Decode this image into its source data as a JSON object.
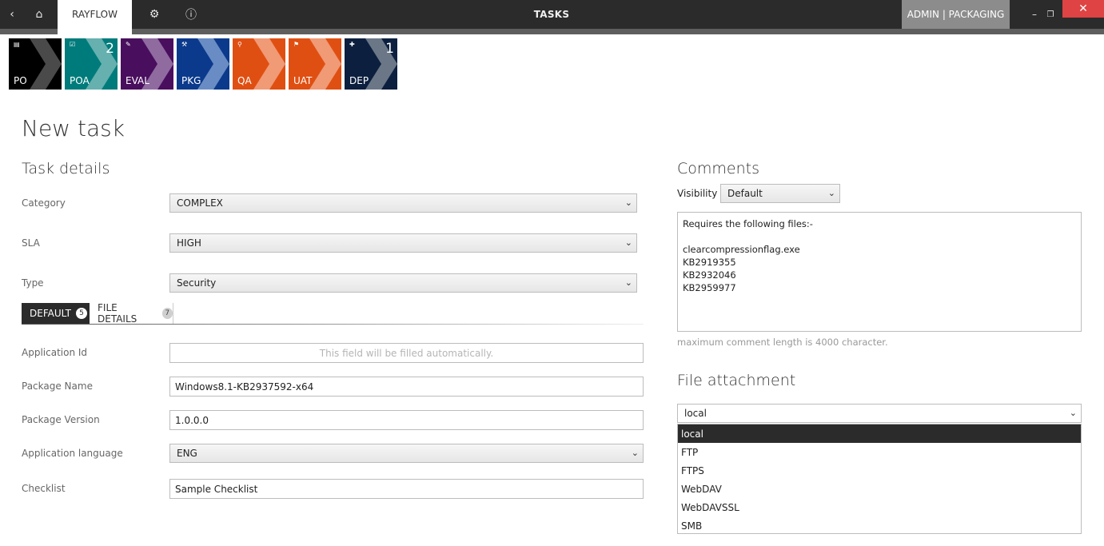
{
  "titlebar": {
    "app_tab": "RAYFLOW",
    "title": "TASKS",
    "user": "ADMIN | PACKAGING",
    "back_icon": "‹",
    "home_icon": "⌂",
    "gear_icon": "⚙",
    "info_icon": "ⓘ",
    "min_icon": "–",
    "max_icon": "❐",
    "close_icon": "✕"
  },
  "phases": [
    {
      "label": "PO",
      "count": "",
      "icon": "▤",
      "color": "#000000",
      "chevron": "#4a4a4a"
    },
    {
      "label": "POA",
      "count": "2",
      "icon": "☑",
      "color": "#007b7b",
      "chevron": "#66b0b0"
    },
    {
      "label": "EVAL",
      "count": "",
      "icon": "✎",
      "color": "#4a0e5e",
      "chevron": "#8f6ba0"
    },
    {
      "label": "PKG",
      "count": "",
      "icon": "⚒",
      "color": "#0b3a8c",
      "chevron": "#6a8cc4"
    },
    {
      "label": "QA",
      "count": "",
      "icon": "⚲",
      "color": "#e04f12",
      "chevron": "#f09a76"
    },
    {
      "label": "UAT",
      "count": "",
      "icon": "⚑",
      "color": "#e04f12",
      "chevron": "#f09a76"
    },
    {
      "label": "DEP",
      "count": "1",
      "icon": "✚",
      "color": "#0c1f3f",
      "chevron": "#6b7787"
    }
  ],
  "page": {
    "title": "New task"
  },
  "task_details": {
    "heading": "Task details",
    "category": {
      "label": "Category",
      "value": "COMPLEX"
    },
    "sla": {
      "label": "SLA",
      "value": "HIGH"
    },
    "type": {
      "label": "Type",
      "value": "Security"
    }
  },
  "tabs": [
    {
      "label": "DEFAULT",
      "badge": "5"
    },
    {
      "label": "FILE DETAILS",
      "badge": "7"
    }
  ],
  "fields": {
    "application_id": {
      "label": "Application Id",
      "placeholder": "This field will be filled automatically."
    },
    "package_name": {
      "label": "Package Name",
      "value": "Windows8.1-KB2937592-x64"
    },
    "package_version": {
      "label": "Package Version",
      "value": "1.0.0.0"
    },
    "application_language": {
      "label": "Application language",
      "value": "ENG"
    },
    "checklist": {
      "label": "Checklist",
      "value": "Sample Checklist"
    }
  },
  "comments": {
    "heading": "Comments",
    "visibility_label": "Visibility",
    "visibility_value": "Default",
    "lines": [
      "Requires the following files:-",
      "",
      "clearcompressionflag.exe",
      "KB2919355",
      "KB2932046",
      "KB2959977"
    ],
    "hint": "maximum comment length is 4000 character."
  },
  "attachment": {
    "heading": "File attachment",
    "selected": "local",
    "options": [
      "local",
      "FTP",
      "FTPS",
      "WebDAV",
      "WebDAVSSL",
      "SMB"
    ]
  },
  "dropdown_arrow": "⌄"
}
